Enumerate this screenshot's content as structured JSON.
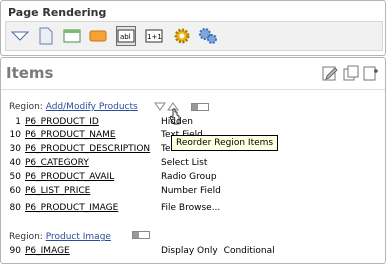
{
  "top_panel": {
    "title": "Page Rendering",
    "toolbar": [
      {
        "icon": "collapse-arrow-icon"
      },
      {
        "icon": "page-icon"
      },
      {
        "icon": "region-icon"
      },
      {
        "icon": "button-icon"
      },
      {
        "icon": "text-item-icon",
        "selected": true
      },
      {
        "icon": "computation-icon"
      },
      {
        "icon": "gear-icon"
      },
      {
        "icon": "process-gears-icon"
      }
    ]
  },
  "items_panel": {
    "title": "Items",
    "regions": [
      {
        "label": "Region:",
        "name": "Add/Modify Products",
        "rows": [
          {
            "seq": "1",
            "name": "P6_PRODUCT_ID",
            "type": "Hidden"
          },
          {
            "seq": "10",
            "name": "P6_PRODUCT_NAME",
            "type": "Text Field"
          },
          {
            "seq": "30",
            "name": "P6_PRODUCT_DESCRIPTION",
            "type": "Textarea"
          },
          {
            "seq": "40",
            "name": "P6_CATEGORY",
            "type": "Select List"
          },
          {
            "seq": "50",
            "name": "P6_PRODUCT_AVAIL",
            "type": "Radio Group"
          },
          {
            "seq": "60",
            "name": "P6_LIST_PRICE",
            "type": "Number Field"
          },
          {
            "seq": "80",
            "name": "P6_PRODUCT_IMAGE",
            "type": "File Browse..."
          }
        ]
      },
      {
        "label": "Region:",
        "name": "Product Image",
        "rows": [
          {
            "seq": "90",
            "name": "P6_IMAGE",
            "type": "Display Only",
            "condition": "Conditional"
          }
        ]
      }
    ],
    "tooltip": "Reorder Region Items"
  }
}
